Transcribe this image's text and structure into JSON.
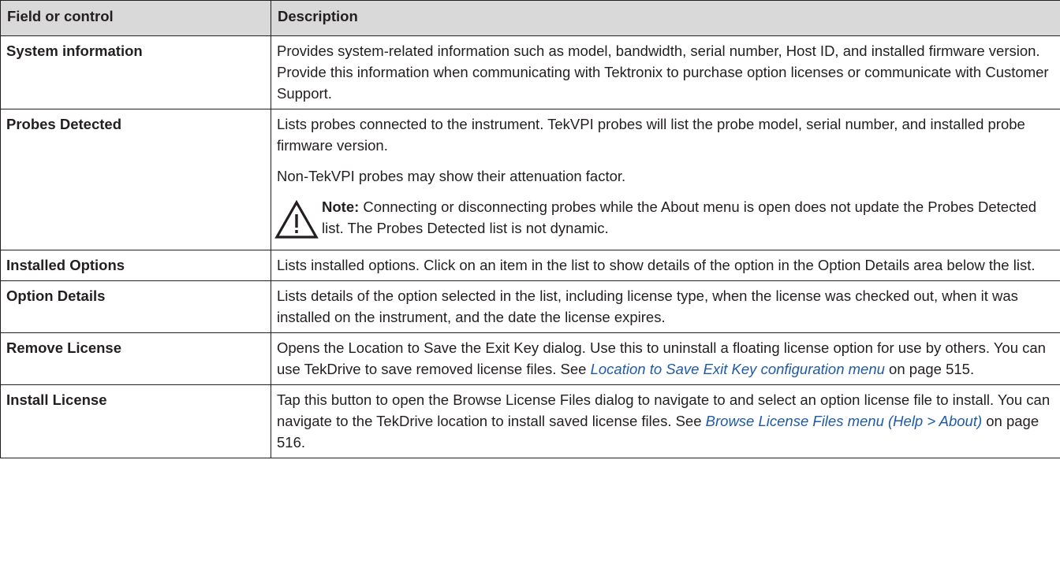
{
  "headers": {
    "col1": "Field or control",
    "col2": "Description"
  },
  "rows": {
    "system": {
      "field": "System information",
      "desc": "Provides system-related information such as model, bandwidth, serial number, Host ID, and installed firmware version. Provide this information when communicating with Tektronix to purchase option licenses or communicate with Customer Support."
    },
    "probes": {
      "field": "Probes Detected",
      "desc1": "Lists probes connected to the instrument. TekVPI probes will list the probe model, serial number, and installed probe firmware version.",
      "desc2": "Non-TekVPI probes may show their attenuation factor.",
      "note_icon": "warning-triangle-icon",
      "note_label": "Note:",
      "note_text": " Connecting or disconnecting probes while the About menu is open does not update the Probes Detected list. The Probes Detected list is not dynamic."
    },
    "installed": {
      "field": "Installed Options",
      "desc": "Lists installed options. Click on an item in the list to show details of the option in the Option Details area below the list."
    },
    "details": {
      "field": "Option Details",
      "desc": "Lists details of the option selected in the list, including license type, when the license was checked out, when it was installed on the instrument, and the date the license expires."
    },
    "remove": {
      "field": "Remove License",
      "desc_pre": "Opens the Location to Save the Exit Key dialog. Use this to uninstall a floating license option for use by others. You can use TekDrive to save removed license files. See ",
      "link": "Location to Save Exit Key configuration menu",
      "desc_post": " on page 515."
    },
    "install": {
      "field": "Install License",
      "desc_pre": "Tap this button to open the Browse License Files dialog to navigate to and select an option license file to install. You can navigate to the TekDrive location to install saved license files. See ",
      "link": "Browse License Files menu (Help > About)",
      "desc_post": " on page 516."
    }
  },
  "colors": {
    "header_bg": "#d9d9d9",
    "border": "#231f20",
    "link": "#1f5aa6"
  }
}
